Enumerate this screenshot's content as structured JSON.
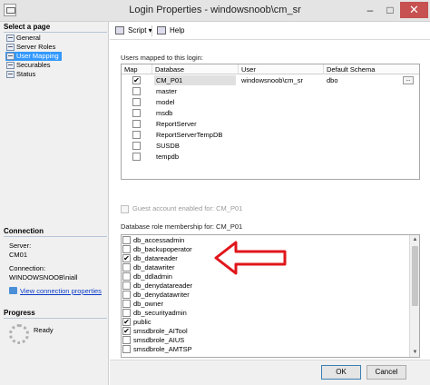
{
  "window": {
    "title": "Login Properties - windowsnoob\\cm_sr"
  },
  "sidebar": {
    "header": "Select a page",
    "items": [
      {
        "label": "General",
        "selected": false
      },
      {
        "label": "Server Roles",
        "selected": false
      },
      {
        "label": "User Mapping",
        "selected": true
      },
      {
        "label": "Securables",
        "selected": false
      },
      {
        "label": "Status",
        "selected": false
      }
    ]
  },
  "connection": {
    "header": "Connection",
    "server_label": "Server:",
    "server_value": "CM01",
    "conn_label": "Connection:",
    "conn_value": "WINDOWSNOOB\\niall",
    "view_link": "View connection properties"
  },
  "progress": {
    "header": "Progress",
    "status": "Ready"
  },
  "toolbar": {
    "script_label": "Script",
    "help_label": "Help"
  },
  "mapping": {
    "group_label": "Users mapped to this login:",
    "columns": [
      "Map",
      "Database",
      "User",
      "Default Schema"
    ],
    "rows": [
      {
        "map": true,
        "database": "CM_P01",
        "user": "windowsnoob\\cm_sr",
        "schema": "dbo"
      },
      {
        "map": false,
        "database": "master",
        "user": "",
        "schema": ""
      },
      {
        "map": false,
        "database": "model",
        "user": "",
        "schema": ""
      },
      {
        "map": false,
        "database": "msdb",
        "user": "",
        "schema": ""
      },
      {
        "map": false,
        "database": "ReportServer",
        "user": "",
        "schema": ""
      },
      {
        "map": false,
        "database": "ReportServerTempDB",
        "user": "",
        "schema": ""
      },
      {
        "map": false,
        "database": "SUSDB",
        "user": "",
        "schema": ""
      },
      {
        "map": false,
        "database": "tempdb",
        "user": "",
        "schema": ""
      }
    ]
  },
  "guest": {
    "label": "Guest account enabled for: CM_P01"
  },
  "roles": {
    "group_label": "Database role membership for: CM_P01",
    "items": [
      {
        "name": "db_accessadmin",
        "checked": false
      },
      {
        "name": "db_backupoperator",
        "checked": false
      },
      {
        "name": "db_datareader",
        "checked": true
      },
      {
        "name": "db_datawriter",
        "checked": false
      },
      {
        "name": "db_ddladmin",
        "checked": false
      },
      {
        "name": "db_denydatareader",
        "checked": false
      },
      {
        "name": "db_denydatawriter",
        "checked": false
      },
      {
        "name": "db_owner",
        "checked": false
      },
      {
        "name": "db_securityadmin",
        "checked": false
      },
      {
        "name": "public",
        "checked": true
      },
      {
        "name": "smsdbrole_AITool",
        "checked": true
      },
      {
        "name": "smsdbrole_AIUS",
        "checked": false
      },
      {
        "name": "smsdbrole_AMTSP",
        "checked": false
      }
    ]
  },
  "buttons": {
    "ok": "OK",
    "cancel": "Cancel"
  },
  "colors": {
    "selection": "#3399ff",
    "arrow": "#e0161b",
    "close": "#c75050"
  }
}
